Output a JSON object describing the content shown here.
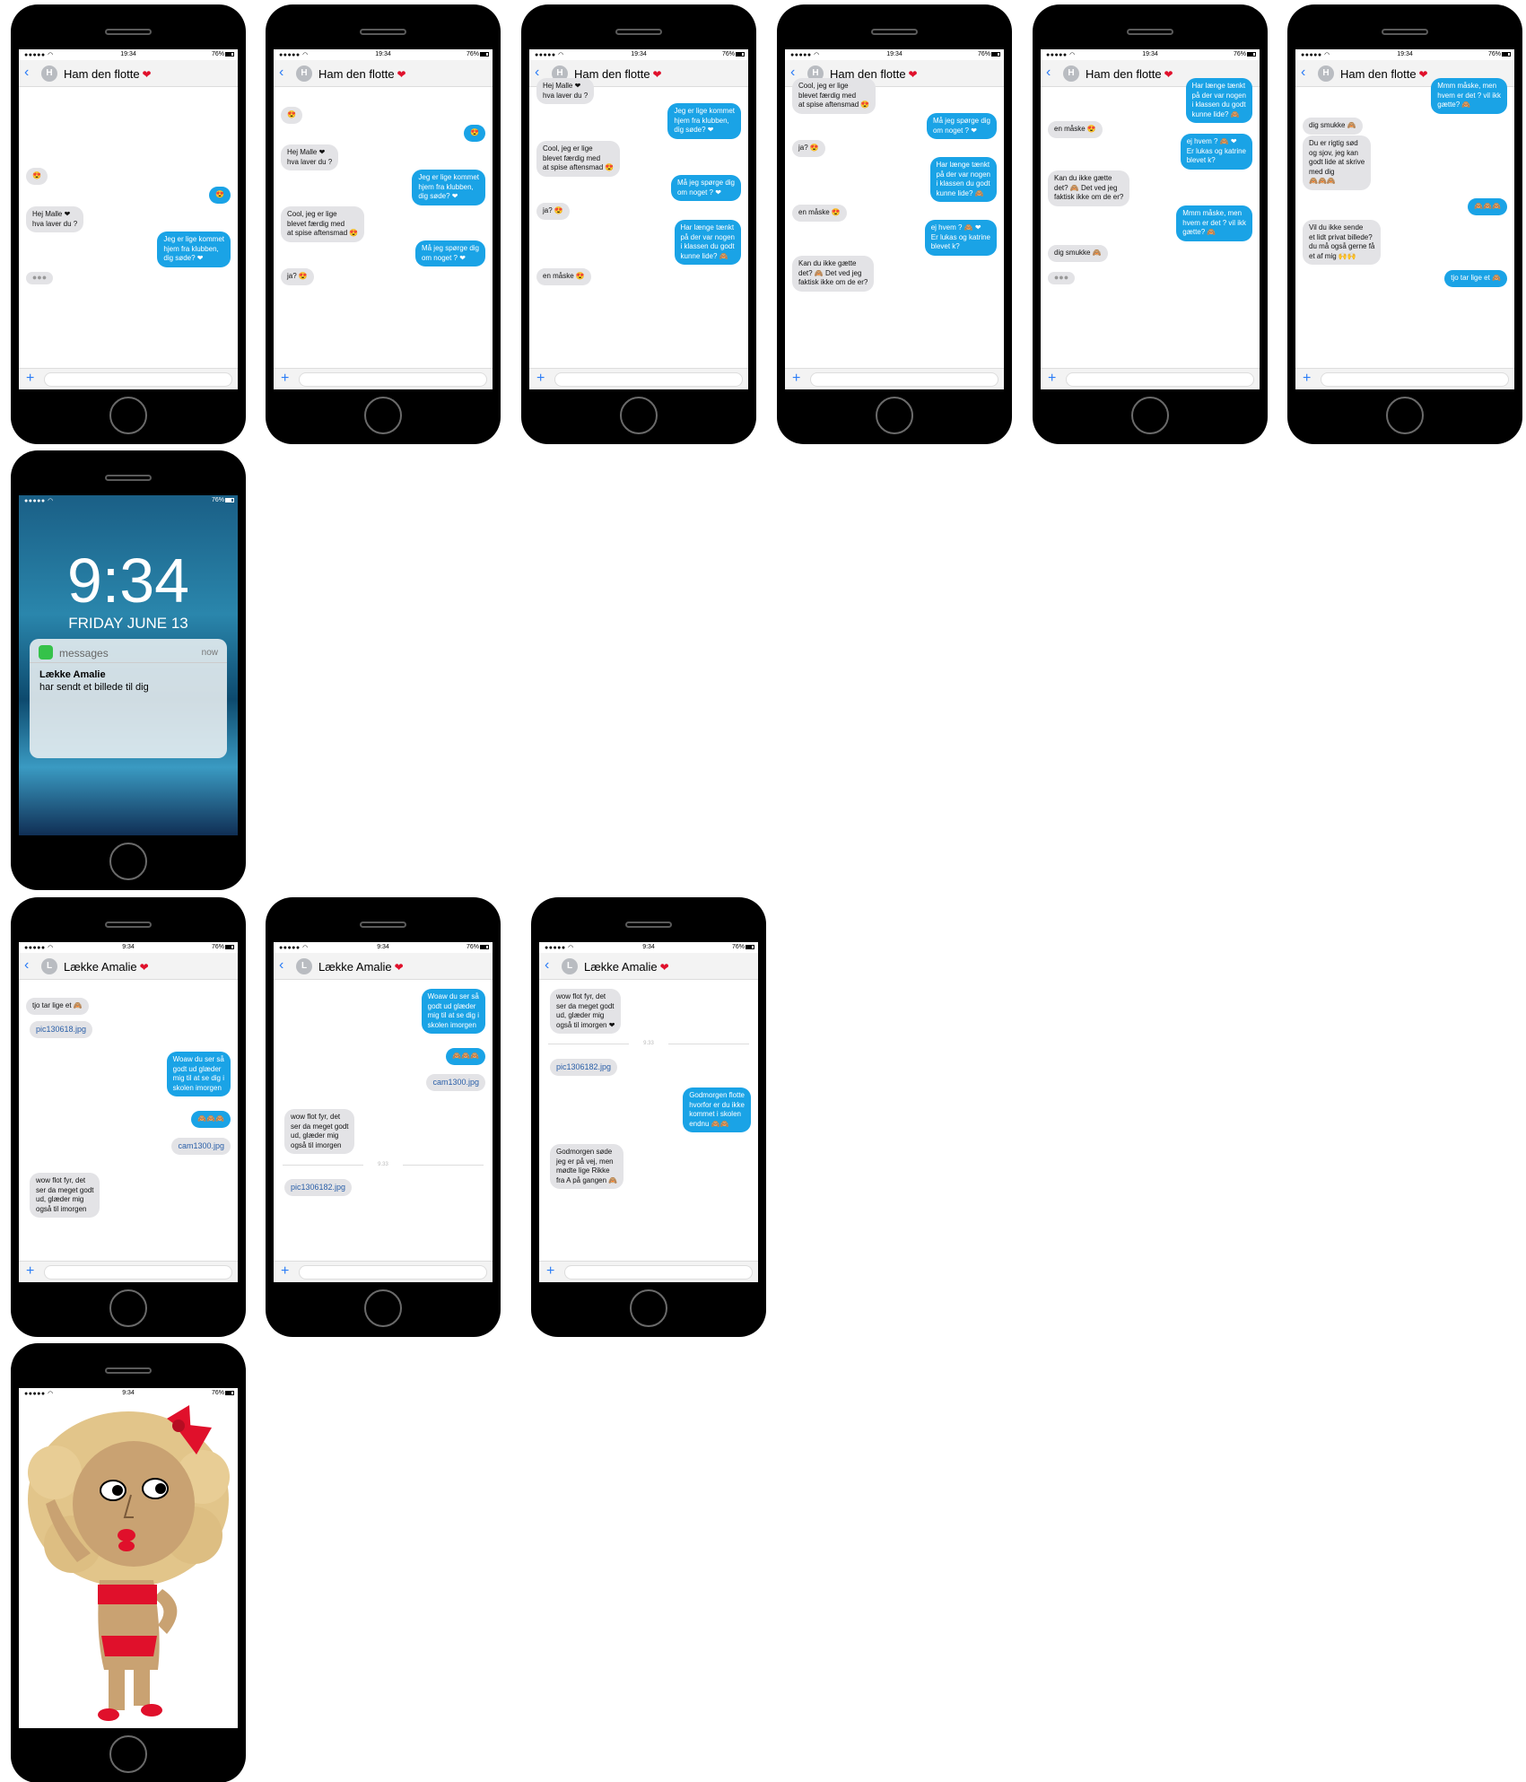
{
  "status": {
    "signal": "●●●●● ◠",
    "time_afternoon": "19:34",
    "time_morning": "9:34",
    "battery": "76%"
  },
  "contacts": {
    "boy": {
      "name": "Ham den flotte",
      "initial": "H"
    },
    "girl": {
      "name": "Lække Amalie",
      "initial": "L"
    }
  },
  "messages": {
    "smile": "😍",
    "hej_malle": "Hej Malle ❤\nhva laver du ?",
    "jeg_er": "Jeg er lige kommet\nhjem fra klubben,\ndig søde? ❤",
    "cool": "Cool, jeg er lige\nblevet færdig med\nat spise aftensmad 😍",
    "maa_jeg": "Må jeg spørge dig\nom noget ? ❤",
    "ja": "ja? 😍",
    "har_laenge": "Har længe tænkt\npå der var nogen\ni klassen du godt\nkunne lide? 🙈",
    "en_maaske": "en måske 😍",
    "ej_hvem": "ej hvem ? 🙈 ❤\nEr lukas og katrine\nblevet k?",
    "kan_du": "Kan du ikke gætte\ndet? 🙈 Det ved jeg\nfaktisk ikke om de er?",
    "mmm": "Mmm måske, men\nhvem er det ? vil ikk\ngætte? 🙈",
    "dig_smukke": "dig smukke 🙈",
    "du_er": "Du er rigtig sød\nog sjov, jeg kan\ngodt lide at skrive\nmed dig\n🙈🙈🙈",
    "monkeys": "🙈🙈🙈",
    "vil_du": "Vil du ikke sende\net lidt privat billede?\ndu må også gerne få\net af mig 🙌🙌",
    "tjo": "tjo tar lige et 🙈",
    "file1": "pic130618.jpg",
    "woaw": "Woaw du ser så\ngodt ud glæder\nmig til at se dig i\nskolen imorgen",
    "cam": "cam1300.jpg",
    "wow": "wow flot fyr, det\nser da meget godt\nud, glæder mig\nogså til imorgen",
    "wow_heart": "wow flot fyr, det\nser da meget godt\nud, glæder mig\nogså til imorgen ❤",
    "stamp": "9.33",
    "file2": "pic1306182.jpg",
    "godmorgen_flotte": "Godmorgen flotte\nhvorfor er du ikke\nkommet i skolen\nendnu 🙈🙈",
    "godmorgen_sode": "Godmorgen søde\njeg er på vej, men\nmødte lige Rikke\nfra A på gangen 🙈",
    "typing": "●●●"
  },
  "lockscreen": {
    "time": "9:34",
    "date": "FRIDAY JUNE 13",
    "app": "messages",
    "when": "now",
    "sender": "Lække Amalie",
    "body": "har sendt et billede til dig"
  },
  "input": {
    "plus": "+"
  },
  "colors": {
    "outgoing": "#1aa3e6",
    "incoming": "#e3e3e6",
    "accent": "#2a7cf6",
    "heart": "#e0102b"
  }
}
